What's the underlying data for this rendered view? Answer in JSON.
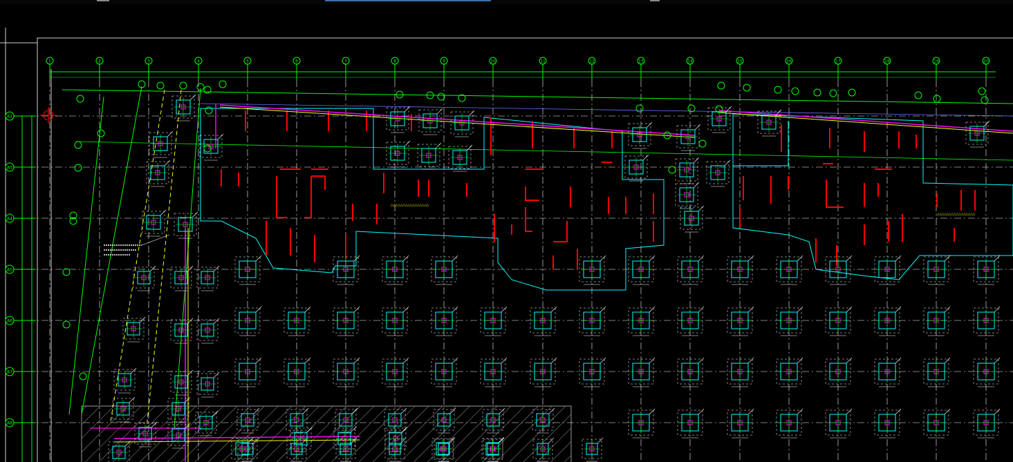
{
  "drawing": {
    "grid_columns": [
      "1",
      "2",
      "3",
      "4",
      "5",
      "6",
      "7",
      "8",
      "9",
      "10",
      "11",
      "12",
      "13",
      "14",
      "15",
      "16",
      "17",
      "18",
      "19",
      "20"
    ],
    "grid_rows": [
      "A2",
      "A3",
      "A4",
      "A5",
      "A6",
      "A7",
      "A8"
    ],
    "colors": {
      "background": "#000000",
      "grid_line": "#00ff00",
      "axis_dash": "#ffffff",
      "pile_cap": "#00ffff",
      "shear_wall": "#ff0000",
      "beam_magenta": "#ff00ff",
      "beam_yellow": "#ffff00",
      "hatch": "#ffffff",
      "label_yellow": "#ffff00"
    },
    "ridge_labels": [
      "△△△△△△△△△△△△△△△△",
      "△△△△△△△△△△△△△△△△"
    ]
  }
}
